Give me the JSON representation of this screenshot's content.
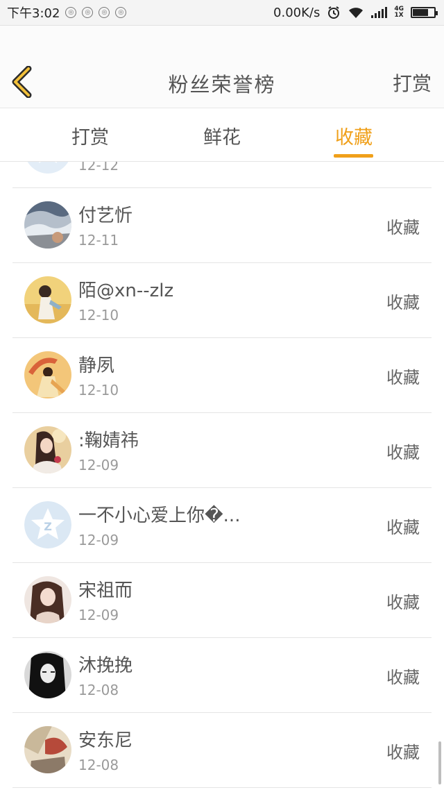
{
  "status_bar": {
    "time": "下午3:02",
    "speed": "0.00K/s",
    "network_top": "4G",
    "network_bottom": "1X"
  },
  "header": {
    "title": "粉丝荣誉榜",
    "right_action": "打赏",
    "back_icon": "chevron-left-icon"
  },
  "tabs": [
    {
      "label": "打赏",
      "active": false
    },
    {
      "label": "鲜花",
      "active": false
    },
    {
      "label": "收藏",
      "active": true
    }
  ],
  "accent_color": "#f0a01a",
  "list": {
    "partial_top": {
      "date": "12-12"
    },
    "rows": [
      {
        "name": "付艺忻",
        "date": "12-11",
        "action": "收藏"
      },
      {
        "name": "陌@xn--zlz",
        "date": "12-10",
        "action": "收藏"
      },
      {
        "name": "静夙",
        "date": "12-10",
        "action": "收藏"
      },
      {
        "name": ":鞠婧祎",
        "date": "12-09",
        "action": "收藏"
      },
      {
        "name": "一不小心爱上你�...",
        "date": "12-09",
        "action": "收藏"
      },
      {
        "name": "宋祖而",
        "date": "12-09",
        "action": "收藏"
      },
      {
        "name": "沐挽挽",
        "date": "12-08",
        "action": "收藏"
      },
      {
        "name": "安东尼",
        "date": "12-08",
        "action": "收藏"
      }
    ]
  }
}
